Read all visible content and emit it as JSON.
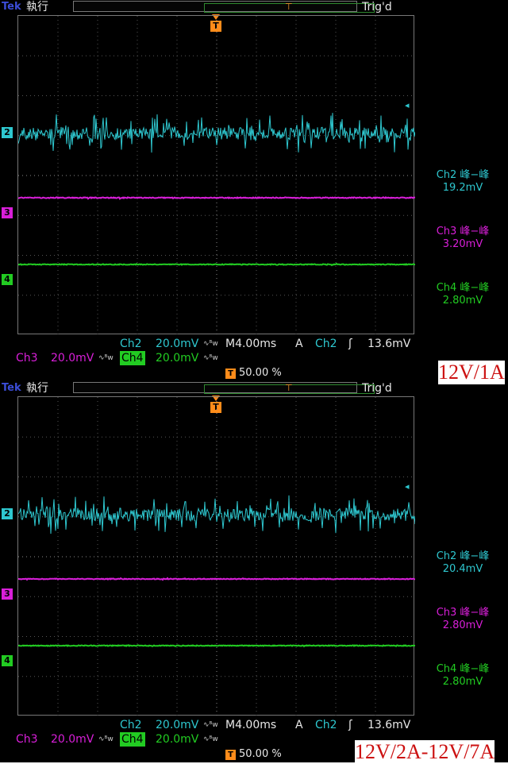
{
  "panels": [
    {
      "brand": "Tek",
      "mode": "執行",
      "trig_status": "Trig'd",
      "trigger_marker": "T",
      "channels": [
        {
          "marker": "2",
          "name": "Ch2",
          "meas_label": "Ch2 峰−峰",
          "meas_value": "19.2mV",
          "color": "#2ec7cf",
          "noise": 19.2
        },
        {
          "marker": "3",
          "name": "Ch3",
          "meas_label": "Ch3 峰−峰",
          "meas_value": "3.20mV",
          "color": "#d91fd9",
          "noise": 3.2
        },
        {
          "marker": "4",
          "name": "Ch4",
          "meas_label": "Ch4 峰−峰",
          "meas_value": "2.80mV",
          "color": "#22cc22",
          "noise": 2.8
        }
      ],
      "status": {
        "ch2_label": "Ch2",
        "ch2_scale": "20.0mV",
        "bw_symbol": "∿ᴮw",
        "timebase": "M4.00ms",
        "acq_mode": "A",
        "trig_source": "Ch2",
        "trig_slope": "ʃ",
        "trig_level": "13.6mV",
        "ch3_label": "Ch3",
        "ch3_scale": "20.0mV",
        "ch4_label": "Ch4",
        "ch4_scale": "20.0mV",
        "trig_position": "50.00 %"
      },
      "caption": "12V/1A"
    },
    {
      "brand": "Tek",
      "mode": "執行",
      "trig_status": "Trig'd",
      "trigger_marker": "T",
      "channels": [
        {
          "marker": "2",
          "name": "Ch2",
          "meas_label": "Ch2 峰−峰",
          "meas_value": "20.4mV",
          "color": "#2ec7cf",
          "noise": 20.4
        },
        {
          "marker": "3",
          "name": "Ch3",
          "meas_label": "Ch3 峰−峰",
          "meas_value": "2.80mV",
          "color": "#d91fd9",
          "noise": 2.8
        },
        {
          "marker": "4",
          "name": "Ch4",
          "meas_label": "Ch4 峰−峰",
          "meas_value": "2.80mV",
          "color": "#22cc22",
          "noise": 2.8
        }
      ],
      "status": {
        "ch2_label": "Ch2",
        "ch2_scale": "20.0mV",
        "bw_symbol": "∿ᴮw",
        "timebase": "M4.00ms",
        "acq_mode": "A",
        "trig_source": "Ch2",
        "trig_slope": "ʃ",
        "trig_level": "13.6mV",
        "ch3_label": "Ch3",
        "ch3_scale": "20.0mV",
        "ch4_label": "Ch4",
        "ch4_scale": "20.0mV",
        "trig_position": "50.00 %"
      },
      "caption": "12V/2A-12V/7A"
    }
  ]
}
